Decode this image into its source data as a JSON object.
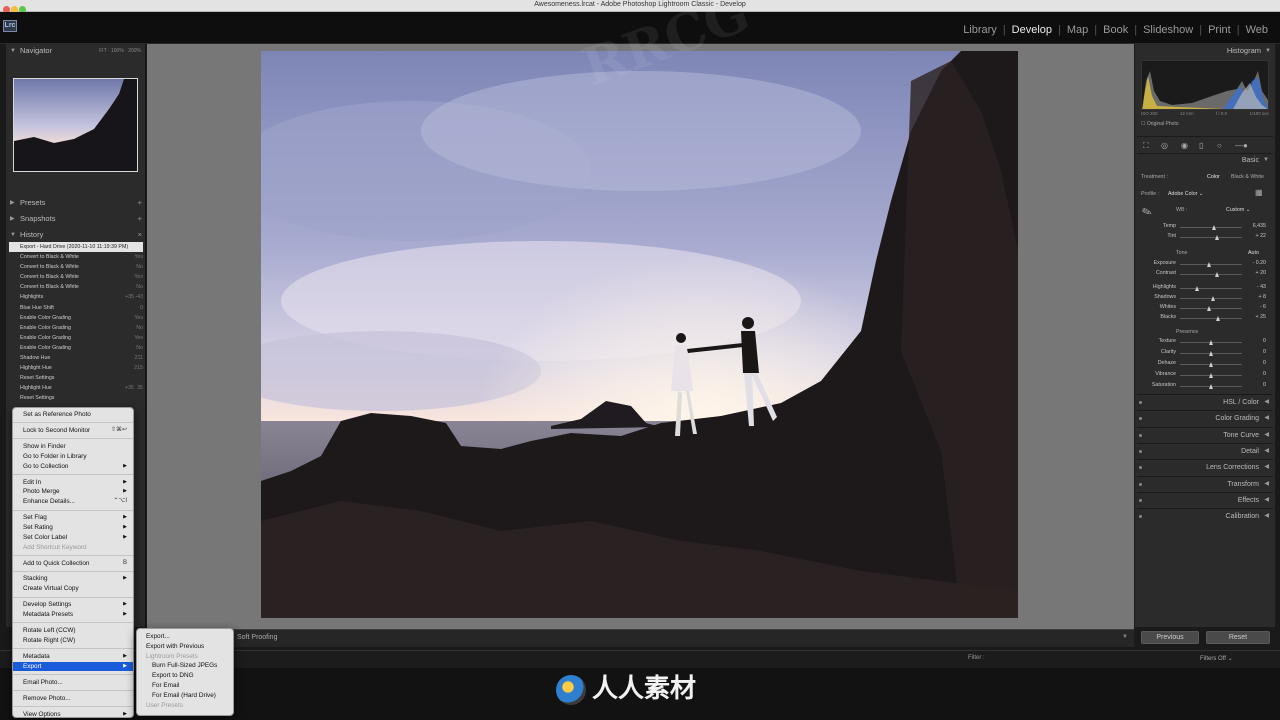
{
  "window": {
    "title": "Awesomeness.lrcat - Adobe Photoshop Lightroom Classic - Develop"
  },
  "app": {
    "badge": "Lrc"
  },
  "modules": [
    {
      "label": "Library",
      "active": false
    },
    {
      "label": "Develop",
      "active": true
    },
    {
      "label": "Map",
      "active": false
    },
    {
      "label": "Book",
      "active": false
    },
    {
      "label": "Slideshow",
      "active": false
    },
    {
      "label": "Print",
      "active": false
    },
    {
      "label": "Web",
      "active": false
    }
  ],
  "left": {
    "navigator": {
      "title": "Navigator",
      "zoom": "FIT  ·  100%  ·  200%"
    },
    "presets": {
      "title": "Presets"
    },
    "snapshots": {
      "title": "Snapshots"
    },
    "history": {
      "title": "History",
      "items": [
        {
          "label": "Export - Hard Drive (2020-11-10 11:19:39 PM)",
          "v1": "",
          "v2": ""
        },
        {
          "label": "Convert to Black & White",
          "v1": "",
          "v2": "Yes"
        },
        {
          "label": "Convert to Black & White",
          "v1": "",
          "v2": "No"
        },
        {
          "label": "Convert to Black & White",
          "v1": "",
          "v2": "Yes"
        },
        {
          "label": "Convert to Black & White",
          "v1": "",
          "v2": "No"
        },
        {
          "label": "Highlights",
          "v1": "+35",
          "v2": "-43"
        },
        {
          "label": "Blue Hue Shift",
          "v1": "",
          "v2": "0"
        },
        {
          "label": "Enable Color Grading",
          "v1": "",
          "v2": "Yes"
        },
        {
          "label": "Enable Color Grading",
          "v1": "",
          "v2": "No"
        },
        {
          "label": "Enable Color Grading",
          "v1": "",
          "v2": "Yes"
        },
        {
          "label": "Enable Color Grading",
          "v1": "",
          "v2": "No"
        },
        {
          "label": "Shadow Hue",
          "v1": "",
          "v2": "211"
        },
        {
          "label": "Highlight Hue",
          "v1": "",
          "v2": "215"
        },
        {
          "label": "Reset Settings",
          "v1": "",
          "v2": ""
        },
        {
          "label": "Highlight Hue",
          "v1": "+35",
          "v2": "35"
        },
        {
          "label": "Reset Settings",
          "v1": "",
          "v2": ""
        }
      ]
    }
  },
  "context_menu": {
    "groups": [
      [
        {
          "label": "Set as Reference Photo"
        }
      ],
      [
        {
          "label": "Lock to Second Monitor",
          "shortcut": "⇧⌘↩"
        }
      ],
      [
        {
          "label": "Show in Finder"
        },
        {
          "label": "Go to Folder in Library"
        },
        {
          "label": "Go to Collection",
          "sub": true
        }
      ],
      [
        {
          "label": "Edit In",
          "sub": true
        },
        {
          "label": "Photo Merge",
          "sub": true
        },
        {
          "label": "Enhance Details...",
          "shortcut": "⌃⌥I"
        }
      ],
      [
        {
          "label": "Set Flag",
          "sub": true
        },
        {
          "label": "Set Rating",
          "sub": true
        },
        {
          "label": "Set Color Label",
          "sub": true
        },
        {
          "label": "Add Shortcut Keyword",
          "disabled": true
        }
      ],
      [
        {
          "label": "Add to Quick Collection",
          "shortcut": "B"
        }
      ],
      [
        {
          "label": "Stacking",
          "sub": true
        },
        {
          "label": "Create Virtual Copy"
        }
      ],
      [
        {
          "label": "Develop Settings",
          "sub": true
        },
        {
          "label": "Metadata Presets",
          "sub": true
        }
      ],
      [
        {
          "label": "Rotate Left (CCW)"
        },
        {
          "label": "Rotate Right (CW)"
        }
      ],
      [
        {
          "label": "Metadata",
          "sub": true
        },
        {
          "label": "Export",
          "sub": true,
          "highlight": true
        }
      ],
      [
        {
          "label": "Email Photo..."
        }
      ],
      [
        {
          "label": "Remove Photo..."
        }
      ],
      [
        {
          "label": "View Options",
          "sub": true
        }
      ]
    ]
  },
  "export_submenu": {
    "items": [
      {
        "label": "Export...",
        "disabled": false,
        "indent": false
      },
      {
        "label": "Export with Previous",
        "disabled": false,
        "indent": false
      },
      {
        "label": "Lightroom Presets",
        "disabled": true,
        "indent": false
      },
      {
        "label": "Burn Full-Sized JPEGs",
        "disabled": false,
        "indent": true
      },
      {
        "label": "Export to DNG",
        "disabled": false,
        "indent": true
      },
      {
        "label": "For Email",
        "disabled": false,
        "indent": true
      },
      {
        "label": "For Email (Hard Drive)",
        "disabled": false,
        "indent": true
      },
      {
        "label": "User Presets",
        "disabled": true,
        "indent": false
      }
    ]
  },
  "toolbar": {
    "soft_proofing": "Soft Proofing"
  },
  "right": {
    "histogram": {
      "title": "Histogram",
      "meta": [
        "ISO 200",
        "12 mm",
        "f / 8.0",
        "1/100 sec"
      ],
      "original_photo": "Original Photo"
    },
    "basic": {
      "title": "Basic",
      "treatment_label": "Treatment :",
      "treatment_color": "Color",
      "treatment_bw": "Black & White",
      "profile_label": "Profile :",
      "profile_value": "Adobe Color",
      "wb_label": "WB :",
      "wb_value": "Custom",
      "tone_label": "Tone",
      "auto_label": "Auto",
      "presence_label": "Presence",
      "sliders_wb": [
        {
          "label": "Temp",
          "value": "6,435",
          "pos": 0.55
        },
        {
          "label": "Tint",
          "value": "+ 22",
          "pos": 0.6
        }
      ],
      "sliders_tone": [
        {
          "label": "Exposure",
          "value": "- 0.20",
          "pos": 0.48
        },
        {
          "label": "Contrast",
          "value": "+ 20",
          "pos": 0.6
        }
      ],
      "sliders_tone2": [
        {
          "label": "Highlights",
          "value": "- 43",
          "pos": 0.28
        },
        {
          "label": "Shadows",
          "value": "+ 8",
          "pos": 0.54
        },
        {
          "label": "Whites",
          "value": "- 6",
          "pos": 0.47
        },
        {
          "label": "Blacks",
          "value": "+ 25",
          "pos": 0.62
        }
      ],
      "sliders_presence": [
        {
          "label": "Texture",
          "value": "0",
          "pos": 0.5
        },
        {
          "label": "Clarity",
          "value": "0",
          "pos": 0.5
        },
        {
          "label": "Dehaze",
          "value": "0",
          "pos": 0.5
        },
        {
          "label": "Vibrance",
          "value": "0",
          "pos": 0.5
        },
        {
          "label": "Saturation",
          "value": "0",
          "pos": 0.5
        }
      ]
    },
    "sections": [
      "HSL / Color",
      "Color Grading",
      "Tone Curve",
      "Detail",
      "Lens Corrections",
      "Transform",
      "Effects",
      "Calibration"
    ],
    "previous_button": "Previous",
    "reset_button": "Reset"
  },
  "filmstrip": {
    "filter_label": "Filter :",
    "filters_off": "Filters Off"
  },
  "watermark": {
    "text": "RRCG",
    "logo_text": "人人素材"
  },
  "colors": {
    "accent": "#1a5bd9",
    "canvas": "#777777",
    "panel": "#2b2b2b"
  }
}
